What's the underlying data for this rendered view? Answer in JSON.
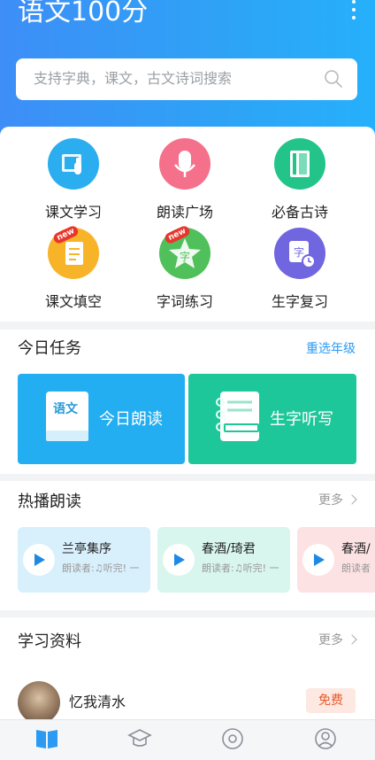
{
  "header": {
    "title": "语文100分"
  },
  "search": {
    "placeholder": "支持字典，课文，古文诗词搜索"
  },
  "features": [
    {
      "label": "课文学习",
      "icon": "textbook-hand-icon",
      "color": "#2aaef0"
    },
    {
      "label": "朗读广场",
      "icon": "microphone-icon",
      "color": "#f5708a"
    },
    {
      "label": "必备古诗",
      "icon": "ancient-book-icon",
      "color": "#23c48a"
    },
    {
      "label": "课文填空",
      "icon": "fill-blank-icon",
      "color": "#f8b429",
      "badge": "new"
    },
    {
      "label": "字词练习",
      "icon": "word-star-icon",
      "color": "#4fc05a",
      "badge": "new"
    },
    {
      "label": "生字复习",
      "icon": "character-review-icon",
      "color": "#7066e0"
    }
  ],
  "tasks": {
    "title": "今日任务",
    "link": "重选年级",
    "items": [
      {
        "label": "今日朗读",
        "book_text": "语文",
        "color": "#24aef2"
      },
      {
        "label": "生字听写",
        "color": "#1ec79a"
      }
    ]
  },
  "hot": {
    "title": "热播朗读",
    "more": "更多",
    "items": [
      {
        "title": "兰亭集序",
        "sub": "朗读者:♫听完! 一",
        "bg": "#d8f0fc"
      },
      {
        "title": "春酒/琦君",
        "sub": "朗读者:♫听完! 一",
        "bg": "#d8f5ee"
      },
      {
        "title": "春酒/",
        "sub": "朗读者",
        "bg": "#fde2e4"
      }
    ]
  },
  "study": {
    "title": "学习资料",
    "more": "更多",
    "item": {
      "name": "忆我清水",
      "badge": "免费"
    }
  },
  "tabbar": {
    "items": [
      {
        "label": "首页",
        "active": true
      },
      {
        "label": "学习",
        "active": false
      },
      {
        "label": "发现",
        "active": false
      },
      {
        "label": "我的",
        "active": false
      }
    ]
  }
}
